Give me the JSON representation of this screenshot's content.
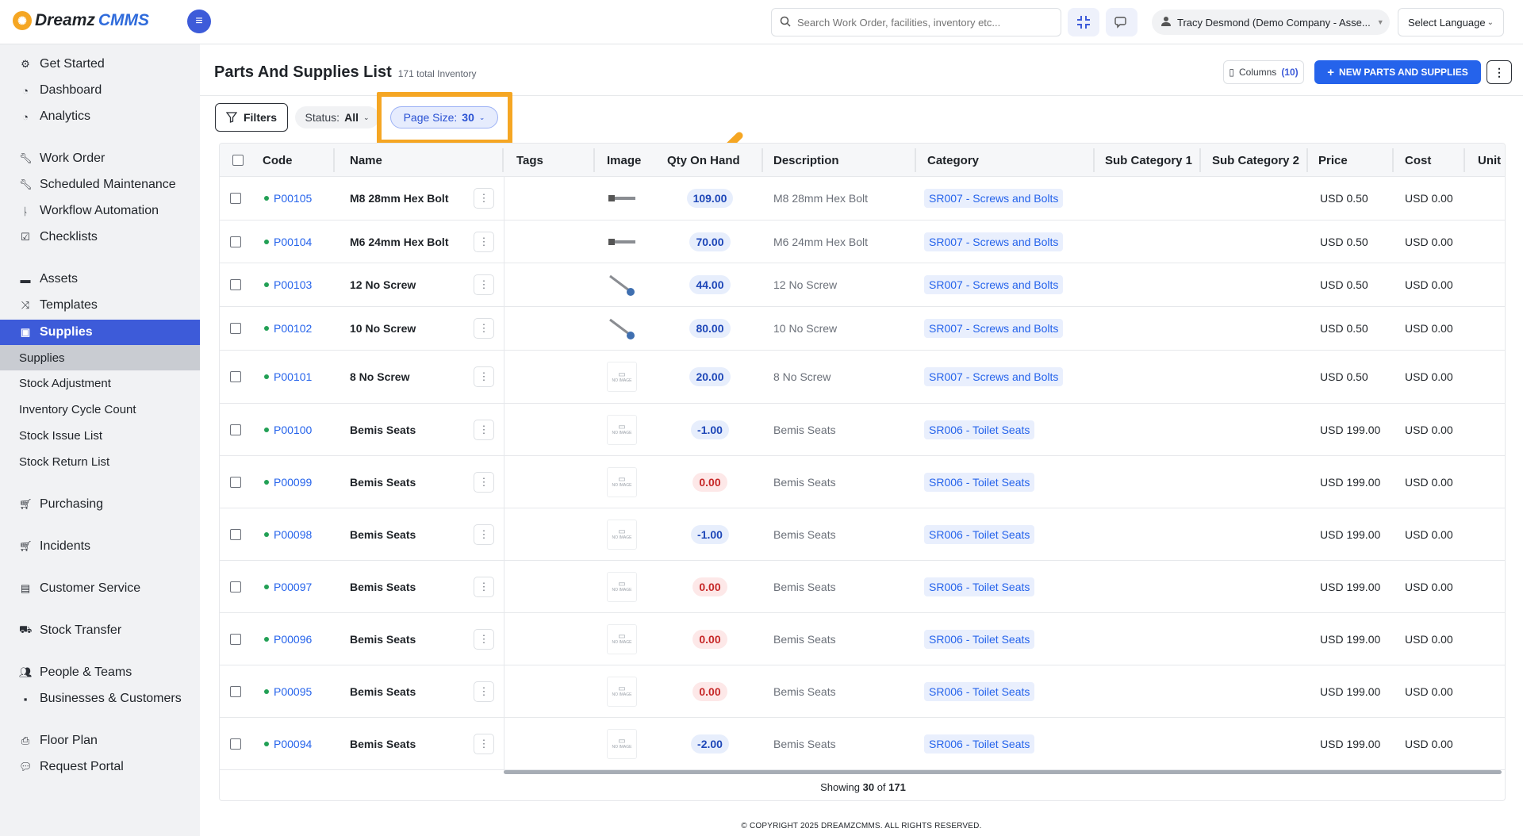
{
  "app": {
    "brand_part1": "Dreamz",
    "brand_part2": "CMMS"
  },
  "topbar": {
    "search_placeholder": "Search Work Order, facilities, inventory etc...",
    "user_label": "Tracy Desmond (Demo Company - Asse...",
    "language_label": "Select Language"
  },
  "sidebar": {
    "items": [
      {
        "label": "Get Started",
        "icon": "gears-icon"
      },
      {
        "label": "Dashboard",
        "icon": "gauge-icon"
      },
      {
        "label": "Analytics",
        "icon": "gauge-icon"
      },
      {
        "label": "Work Order",
        "icon": "wrench-icon"
      },
      {
        "label": "Scheduled Maintenance",
        "icon": "wrench-icon"
      },
      {
        "label": "Workflow Automation",
        "icon": "branch-icon"
      },
      {
        "label": "Checklists",
        "icon": "checkbox-icon"
      },
      {
        "label": "Assets",
        "icon": "archive-icon"
      },
      {
        "label": "Templates",
        "icon": "shuffle-icon"
      },
      {
        "label": "Supplies",
        "icon": "briefcase-icon"
      },
      {
        "label": "Purchasing",
        "icon": "cart-icon"
      },
      {
        "label": "Incidents",
        "icon": "cart-icon"
      },
      {
        "label": "Customer Service",
        "icon": "file-icon"
      },
      {
        "label": "Stock Transfer",
        "icon": "truck-icon"
      },
      {
        "label": "People & Teams",
        "icon": "users-icon"
      },
      {
        "label": "Businesses & Customers",
        "icon": "id-card-icon"
      },
      {
        "label": "Floor Plan",
        "icon": "print-icon"
      },
      {
        "label": "Request Portal",
        "icon": "chat-icon"
      }
    ],
    "sub_items": [
      {
        "label": "Supplies"
      },
      {
        "label": "Stock Adjustment"
      },
      {
        "label": "Inventory Cycle Count"
      },
      {
        "label": "Stock Issue List"
      },
      {
        "label": "Stock Return List"
      }
    ],
    "active_color": "#3d5bd9"
  },
  "page": {
    "title": "Parts And Supplies List",
    "subtitle": "171 total Inventory",
    "columns_label": "Columns",
    "columns_count": "(10)",
    "new_button_label": "NEW PARTS AND SUPPLIES",
    "filters_label": "Filters",
    "status_label": "Status:",
    "status_value": "All",
    "page_size_label": "Page Size:",
    "page_size_value": "30",
    "showing_prefix": "Showing",
    "showing_count": "30",
    "showing_of": "of",
    "showing_total": "171",
    "footer": "© COPYRIGHT 2025 DREAMZCMMS. ALL RIGHTS RESERVED."
  },
  "table": {
    "headers": [
      "Code",
      "Name",
      "Tags",
      "Image",
      "Qty On Hand",
      "Description",
      "Category",
      "Sub Category 1",
      "Sub Category 2",
      "Price",
      "Cost",
      "Unit"
    ],
    "rows": [
      {
        "code": "P00105",
        "name": "M8 28mm Hex Bolt",
        "image": "bolt",
        "qty": "109.00",
        "qty_state": "pos",
        "description": "M8 28mm Hex Bolt",
        "category": "SR007 - Screws and Bolts",
        "price": "USD 0.50",
        "cost": "USD 0.00"
      },
      {
        "code": "P00104",
        "name": "M6 24mm Hex Bolt",
        "image": "bolt",
        "qty": "70.00",
        "qty_state": "pos",
        "description": "M6 24mm Hex Bolt",
        "category": "SR007 - Screws and Bolts",
        "price": "USD 0.50",
        "cost": "USD 0.00"
      },
      {
        "code": "P00103",
        "name": "12 No Screw",
        "image": "screw",
        "qty": "44.00",
        "qty_state": "pos",
        "description": "12 No Screw",
        "category": "SR007 - Screws and Bolts",
        "price": "USD 0.50",
        "cost": "USD 0.00"
      },
      {
        "code": "P00102",
        "name": "10 No Screw",
        "image": "screw",
        "qty": "80.00",
        "qty_state": "pos",
        "description": "10 No Screw",
        "category": "SR007 - Screws and Bolts",
        "price": "USD 0.50",
        "cost": "USD 0.00"
      },
      {
        "code": "P00101",
        "name": "8 No Screw",
        "image": "none",
        "qty": "20.00",
        "qty_state": "pos",
        "description": "8 No Screw",
        "category": "SR007 - Screws and Bolts",
        "price": "USD 0.50",
        "cost": "USD 0.00"
      },
      {
        "code": "P00100",
        "name": "Bemis Seats",
        "image": "none",
        "qty": "-1.00",
        "qty_state": "neg",
        "description": "Bemis Seats",
        "category": "SR006 - Toilet Seats",
        "price": "USD 199.00",
        "cost": "USD 0.00"
      },
      {
        "code": "P00099",
        "name": "Bemis Seats",
        "image": "none",
        "qty": "0.00",
        "qty_state": "zero",
        "description": "Bemis Seats",
        "category": "SR006 - Toilet Seats",
        "price": "USD 199.00",
        "cost": "USD 0.00"
      },
      {
        "code": "P00098",
        "name": "Bemis Seats",
        "image": "none",
        "qty": "-1.00",
        "qty_state": "neg",
        "description": "Bemis Seats",
        "category": "SR006 - Toilet Seats",
        "price": "USD 199.00",
        "cost": "USD 0.00"
      },
      {
        "code": "P00097",
        "name": "Bemis Seats",
        "image": "none",
        "qty": "0.00",
        "qty_state": "zero",
        "description": "Bemis Seats",
        "category": "SR006 - Toilet Seats",
        "price": "USD 199.00",
        "cost": "USD 0.00"
      },
      {
        "code": "P00096",
        "name": "Bemis Seats",
        "image": "none",
        "qty": "0.00",
        "qty_state": "zero",
        "description": "Bemis Seats",
        "category": "SR006 - Toilet Seats",
        "price": "USD 199.00",
        "cost": "USD 0.00"
      },
      {
        "code": "P00095",
        "name": "Bemis Seats",
        "image": "none",
        "qty": "0.00",
        "qty_state": "zero",
        "description": "Bemis Seats",
        "category": "SR006 - Toilet Seats",
        "price": "USD 199.00",
        "cost": "USD 0.00"
      },
      {
        "code": "P00094",
        "name": "Bemis Seats",
        "image": "none",
        "qty": "-2.00",
        "qty_state": "neg",
        "description": "Bemis Seats",
        "category": "SR006 - Toilet Seats",
        "price": "USD 199.00",
        "cost": "USD 0.00"
      }
    ],
    "no_image_text": "NO IMAGE"
  },
  "colors": {
    "primary": "#2563eb",
    "highlight": "#f5a623",
    "in_stock_dot": "#22a055",
    "zero_qty": "#c62828"
  }
}
